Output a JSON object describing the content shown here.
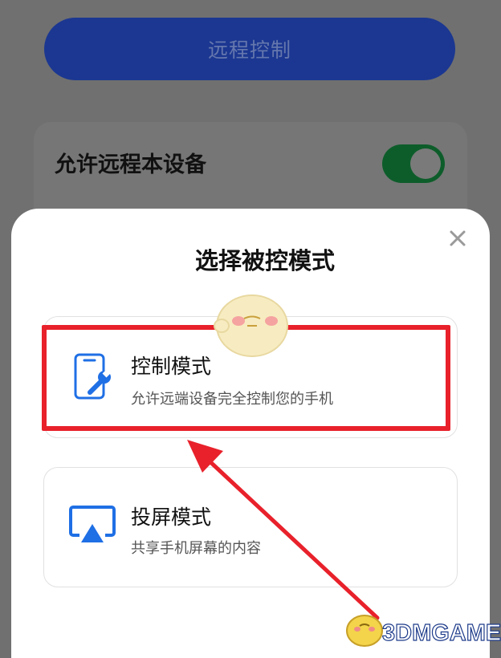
{
  "background": {
    "remote_button_label": "远程控制",
    "allow_label": "允许远程本设备",
    "allow_toggle_on": true
  },
  "sheet": {
    "title": "选择被控模式",
    "modes": [
      {
        "title": "控制模式",
        "description": "允许远端设备完全控制您的手机",
        "icon": "phone-wrench-icon"
      },
      {
        "title": "投屏模式",
        "description": "共享手机屏幕的内容",
        "icon": "screen-cast-icon"
      }
    ]
  },
  "annotation": {
    "highlight_color": "#e8212b"
  },
  "watermark": {
    "text": "3DMGAME"
  },
  "colors": {
    "accent_blue": "#1f6fe5",
    "overlay_gray": "#707070",
    "toggle_green": "#0d5d2a"
  }
}
